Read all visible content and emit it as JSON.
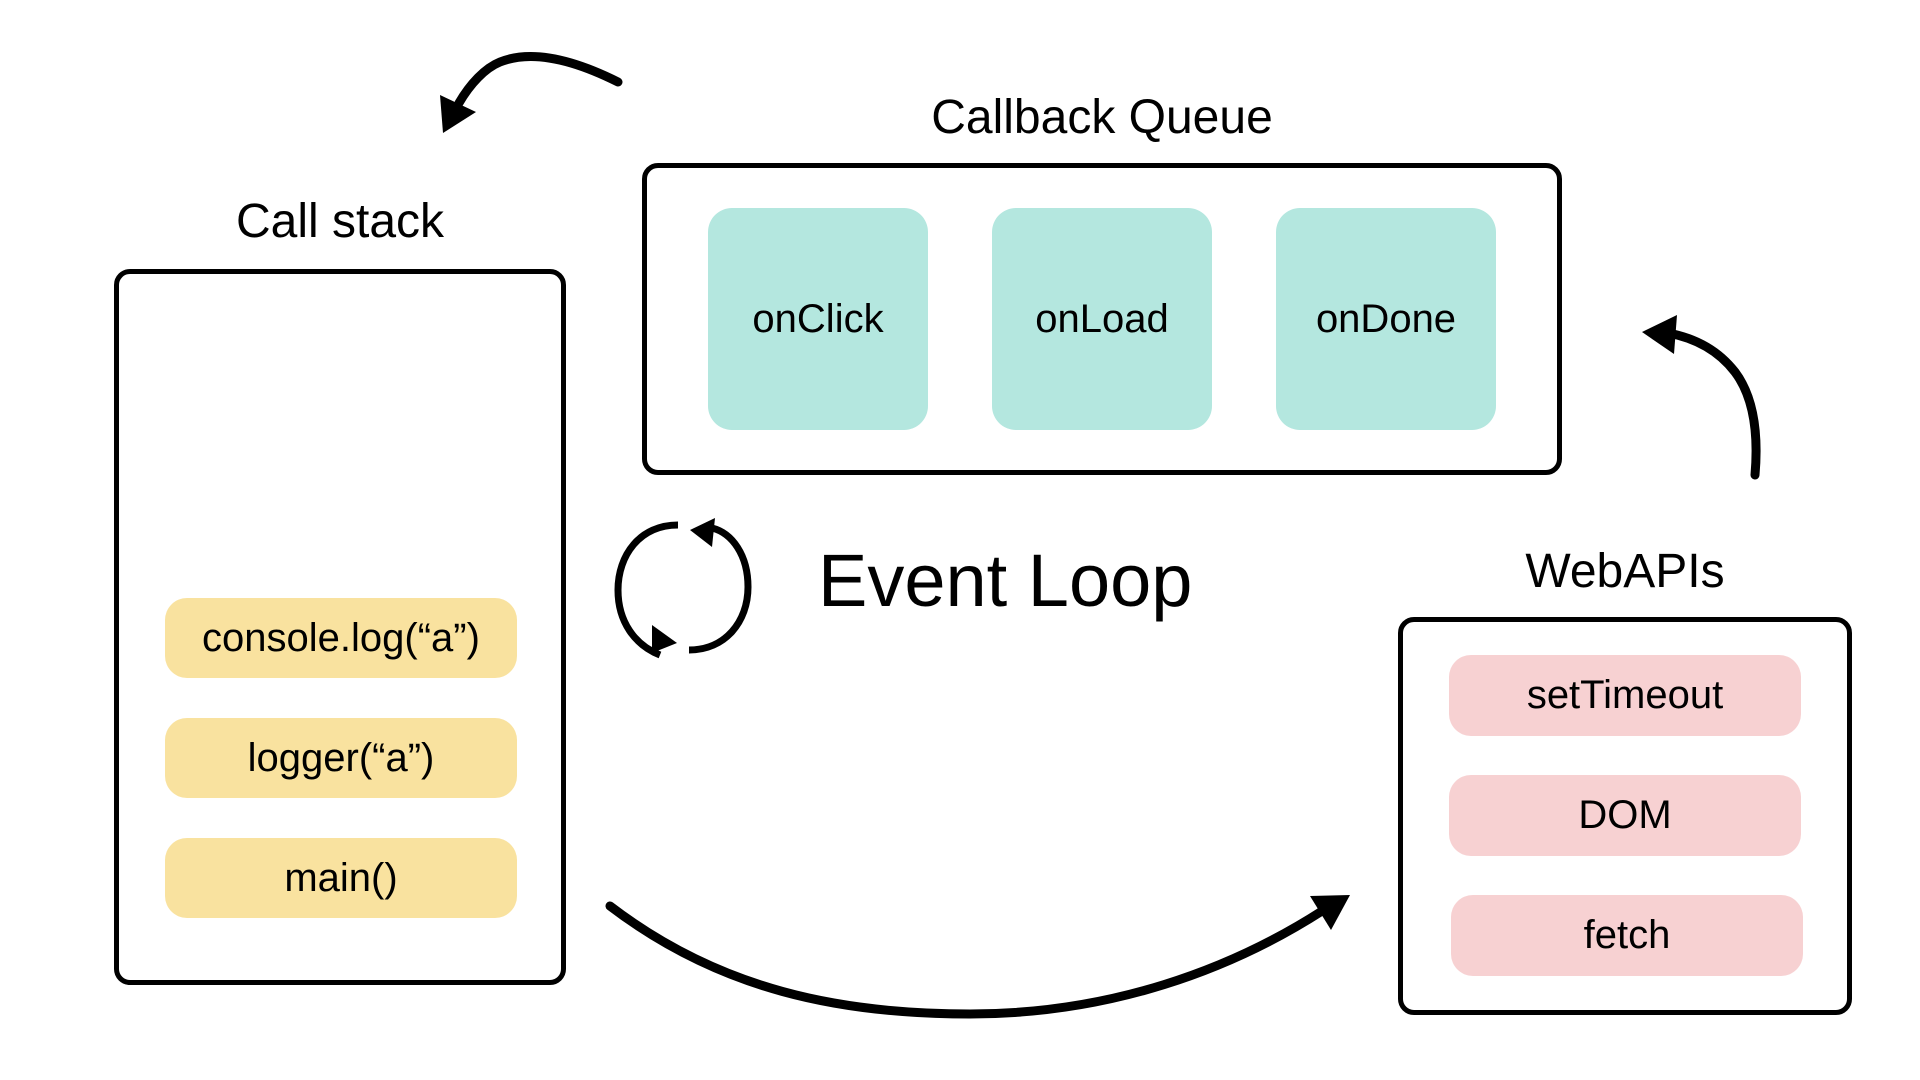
{
  "call_stack": {
    "title": "Call stack",
    "items": [
      {
        "label": "console.log(“a”)"
      },
      {
        "label": "logger(“a”)"
      },
      {
        "label": "main()"
      }
    ]
  },
  "callback_queue": {
    "title": "Callback Queue",
    "items": [
      {
        "label": "onClick"
      },
      {
        "label": "onLoad"
      },
      {
        "label": "onDone"
      }
    ]
  },
  "web_apis": {
    "title": "WebAPIs",
    "items": [
      {
        "label": "setTimeout"
      },
      {
        "label": "DOM"
      },
      {
        "label": "fetch"
      }
    ]
  },
  "event_loop": {
    "title": "Event Loop",
    "icon": "cycle-arrows-icon"
  },
  "colors": {
    "stack_item": "#F9E29F",
    "queue_item": "#B4E7DF",
    "api_item": "#F7D1D2",
    "stroke": "#000000"
  }
}
